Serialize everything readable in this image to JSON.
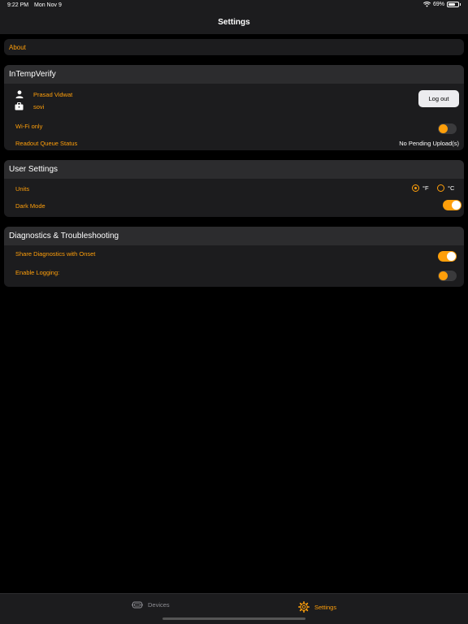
{
  "status_bar": {
    "time": "9:22 PM",
    "date": "Mon Nov 9",
    "battery": "69%",
    "battery_level": 0.69
  },
  "nav": {
    "title": "Settings"
  },
  "about": {
    "label": "About"
  },
  "intempverify": {
    "header": "InTempVerify",
    "user_name": "Prasad Vidwat",
    "organization": "sovi",
    "logout_label": "Log out",
    "wifi_only_label": "Wi-Fi only",
    "wifi_only_on": false,
    "readout_label": "Readout Queue Status",
    "readout_value": "No Pending Upload(s)"
  },
  "user_settings": {
    "header": "User Settings",
    "units_label": "Units",
    "unit_f": "°F",
    "unit_c": "°C",
    "selected_unit": "°F",
    "dark_mode_label": "Dark Mode",
    "dark_mode_on": true
  },
  "diagnostics": {
    "header": "Diagnostics & Troubleshooting",
    "share_label": "Share Diagnostics with Onset",
    "share_on": true,
    "logging_label": "Enable Logging:",
    "logging_on": false
  },
  "tab_bar": {
    "tabs": [
      {
        "label": "Devices",
        "icon": "devices-icon",
        "active": false
      },
      {
        "label": "Settings",
        "icon": "gear-icon",
        "active": true
      }
    ]
  },
  "colors": {
    "accent": "#ff9f0a",
    "background": "#000000",
    "card": "#1c1c1e",
    "header": "#2c2c2e"
  }
}
